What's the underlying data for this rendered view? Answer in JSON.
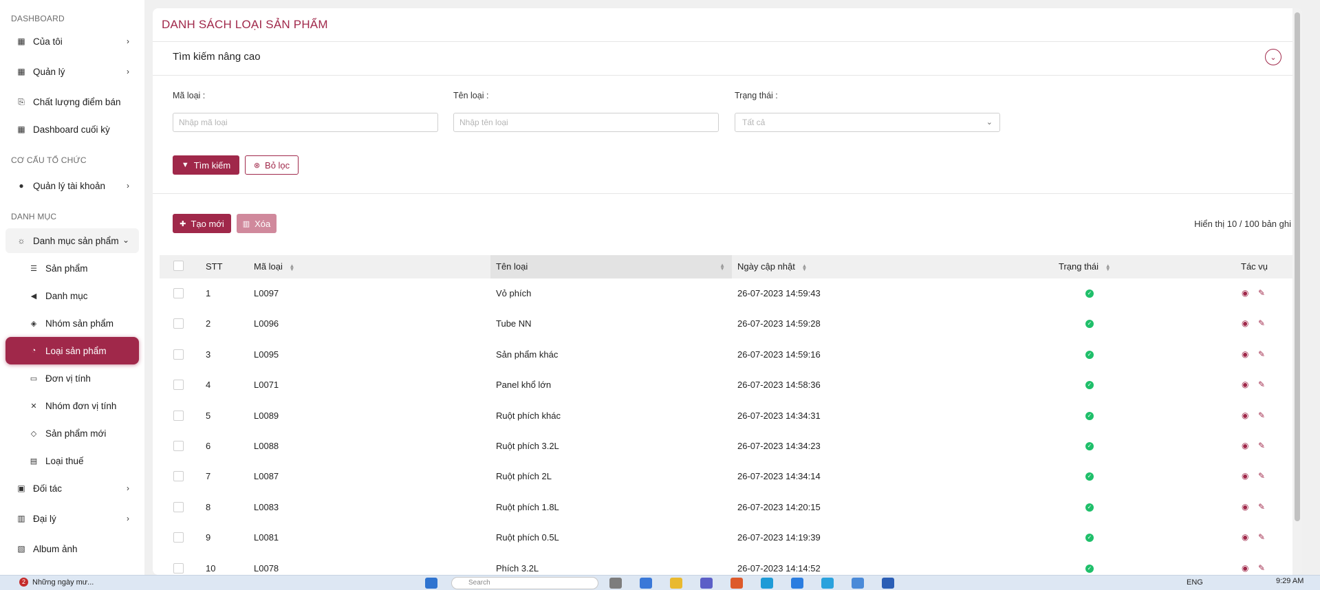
{
  "sidebar": {
    "section_dashboard": "DASHBOARD",
    "dashboard_items": [
      {
        "label": "Của tôi"
      },
      {
        "label": "Quản lý"
      },
      {
        "label": "Chất lượng điểm bán"
      },
      {
        "label": "Dashboard cuối kỳ"
      }
    ],
    "section_org": "CƠ CẤU TỔ CHỨC",
    "org_items": [
      {
        "label": "Quản lý tài khoản"
      }
    ],
    "section_catalog": "DANH MỤC",
    "catalog_parent": "Danh mục sản phẩm",
    "catalog_subs": [
      {
        "label": "Sản phẩm"
      },
      {
        "label": "Danh mục"
      },
      {
        "label": "Nhóm sản phẩm"
      },
      {
        "label": "Loại sản phẩm"
      },
      {
        "label": "Đơn vị tính"
      },
      {
        "label": "Nhóm đơn vị tính"
      },
      {
        "label": "Sản phẩm mới"
      },
      {
        "label": "Loại thuế"
      }
    ],
    "other_items": [
      {
        "label": "Đối tác"
      },
      {
        "label": "Đại lý"
      },
      {
        "label": "Album ảnh"
      }
    ]
  },
  "page": {
    "title": "DANH SÁCH LOẠI SẢN PHẨM",
    "advanced_search": "Tìm kiếm nâng cao"
  },
  "filters": {
    "code_label": "Mã loại :",
    "code_placeholder": "Nhập mã loại",
    "name_label": "Tên loại :",
    "name_placeholder": "Nhập tên loại",
    "status_label": "Trạng thái :",
    "status_value": "Tất cả",
    "search_button": "Tìm kiếm",
    "clear_button": "Bỏ lọc"
  },
  "toolbar": {
    "create_button": "Tạo mới",
    "delete_button": "Xóa",
    "count_text": "Hiển thị 10 / 100 bản ghi"
  },
  "table": {
    "headers": {
      "stt": "STT",
      "code": "Mã loại",
      "name": "Tên loại",
      "updated": "Ngày cập nhật",
      "status": "Trạng thái",
      "actions": "Tác vụ"
    },
    "rows": [
      {
        "stt": "1",
        "code": "L0097",
        "name": "Vỏ phích",
        "updated": "26-07-2023 14:59:43"
      },
      {
        "stt": "2",
        "code": "L0096",
        "name": "Tube NN",
        "updated": "26-07-2023 14:59:28"
      },
      {
        "stt": "3",
        "code": "L0095",
        "name": "Sản phẩm khác",
        "updated": "26-07-2023 14:59:16"
      },
      {
        "stt": "4",
        "code": "L0071",
        "name": "Panel khổ lớn",
        "updated": "26-07-2023 14:58:36"
      },
      {
        "stt": "5",
        "code": "L0089",
        "name": "Ruột phích khác",
        "updated": "26-07-2023 14:34:31"
      },
      {
        "stt": "6",
        "code": "L0088",
        "name": "Ruột phích 3.2L",
        "updated": "26-07-2023 14:34:23"
      },
      {
        "stt": "7",
        "code": "L0087",
        "name": "Ruột phích 2L",
        "updated": "26-07-2023 14:34:14"
      },
      {
        "stt": "8",
        "code": "L0083",
        "name": "Ruột phích 1.8L",
        "updated": "26-07-2023 14:20:15"
      },
      {
        "stt": "9",
        "code": "L0081",
        "name": "Ruột phích 0.5L",
        "updated": "26-07-2023 14:19:39"
      },
      {
        "stt": "10",
        "code": "L0078",
        "name": "Phích 3.2L",
        "updated": "26-07-2023 14:14:52"
      }
    ]
  },
  "taskbar": {
    "notif_count": "2",
    "app_label": "Những ngày mư...",
    "search_placeholder": "Search",
    "lang": "ENG",
    "time": "9:29 AM"
  },
  "colors": {
    "accent": "#a0284a",
    "status_active": "#1fbf6a"
  }
}
